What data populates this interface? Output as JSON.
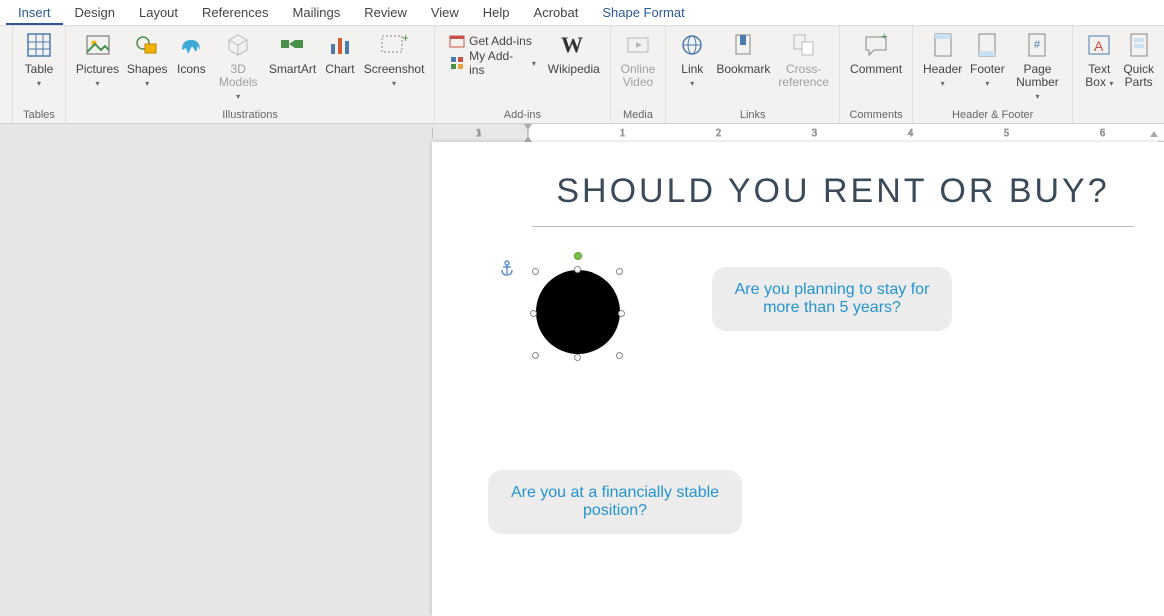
{
  "tabs": {
    "insert": "Insert",
    "design": "Design",
    "layout": "Layout",
    "references": "References",
    "mailings": "Mailings",
    "review": "Review",
    "view": "View",
    "help": "Help",
    "acrobat": "Acrobat",
    "shapeformat": "Shape Format"
  },
  "ribbon": {
    "table": "Table",
    "pictures": "Pictures",
    "shapes": "Shapes",
    "icons": "Icons",
    "models3d_l1": "3D",
    "models3d_l2": "Models",
    "smartart": "SmartArt",
    "chart": "Chart",
    "screenshot": "Screenshot",
    "getaddins": "Get Add-ins",
    "myaddins": "My Add-ins",
    "wikipedia": "Wikipedia",
    "onlinevideo_l1": "Online",
    "onlinevideo_l2": "Video",
    "link": "Link",
    "bookmark": "Bookmark",
    "crossref_l1": "Cross-",
    "crossref_l2": "reference",
    "comment": "Comment",
    "header": "Header",
    "footer": "Footer",
    "pagenumber_l1": "Page",
    "pagenumber_l2": "Number",
    "textbox_l1": "Text",
    "textbox_l2": "Box",
    "quickparts_l1": "Quick",
    "quickparts_l2": "Parts"
  },
  "groups": {
    "tables": "Tables",
    "illustrations": "Illustrations",
    "addins": "Add-ins",
    "media": "Media",
    "links": "Links",
    "comments": "Comments",
    "headerfooter": "Header & Footer"
  },
  "document": {
    "title": "SHOULD YOU RENT OR BUY?",
    "bubble1": "Are you planning to stay for more than 5 years?",
    "bubble2": "Are you at a financially stable position?"
  },
  "ruler_marks": [
    "1",
    "1",
    "2",
    "3",
    "4",
    "5",
    "6"
  ]
}
